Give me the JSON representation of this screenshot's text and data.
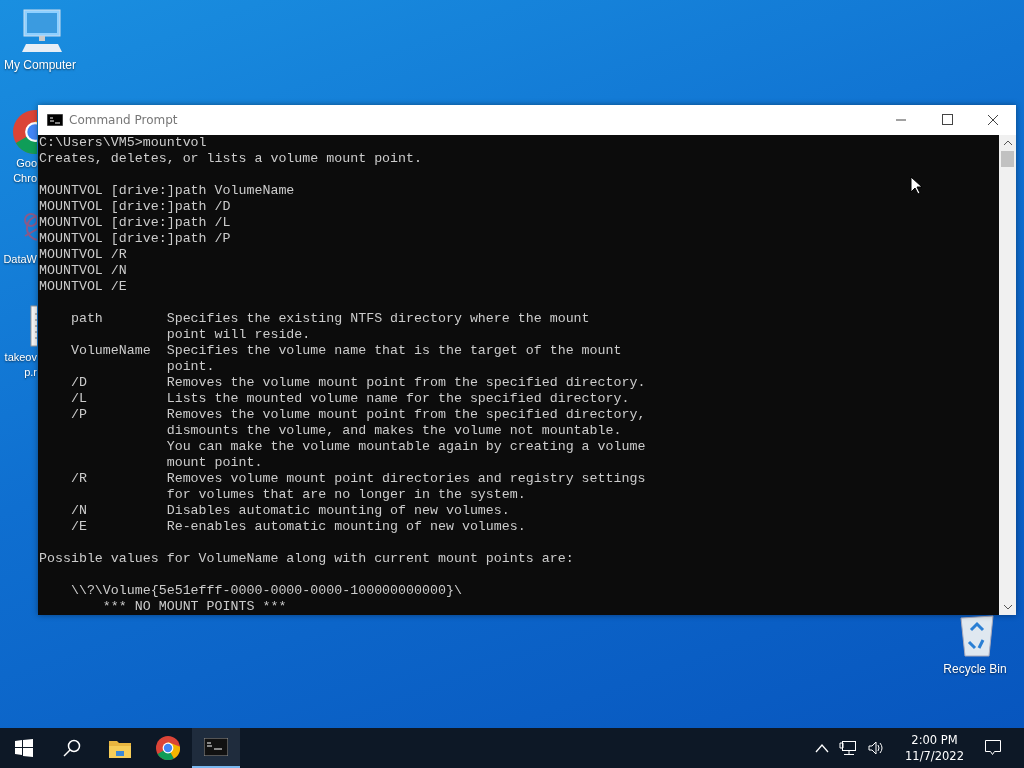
{
  "desktop_icons": [
    {
      "kind": "computer",
      "label": [
        "My Computer"
      ]
    },
    {
      "kind": "chrome",
      "label": [
        "Goo",
        "Chro"
      ]
    },
    {
      "kind": "app",
      "label": [
        "DataW"
      ]
    },
    {
      "kind": "document",
      "label": [
        "takeov",
        "p.r"
      ]
    },
    {
      "kind": "recycle",
      "label": [
        "Recycle Bin"
      ]
    }
  ],
  "window": {
    "title": "Command Prompt",
    "output_blocks": [
      [
        "C:\\Users\\VM5>mountvol",
        "Creates, deletes, or lists a volume mount point."
      ],
      [
        "MOUNTVOL [drive:]path VolumeName",
        "MOUNTVOL [drive:]path /D",
        "MOUNTVOL [drive:]path /L",
        "MOUNTVOL [drive:]path /P",
        "MOUNTVOL /R",
        "MOUNTVOL /N",
        "MOUNTVOL /E"
      ],
      [
        "    path        Specifies the existing NTFS directory where the mount",
        "                point will reside.",
        "    VolumeName  Specifies the volume name that is the target of the mount",
        "                point.",
        "    /D          Removes the volume mount point from the specified directory.",
        "    /L          Lists the mounted volume name for the specified directory.",
        "    /P          Removes the volume mount point from the specified directory,",
        "                dismounts the volume, and makes the volume not mountable.",
        "                You can make the volume mountable again by creating a volume",
        "                mount point.",
        "    /R          Removes volume mount point directories and registry settings",
        "                for volumes that are no longer in the system.",
        "    /N          Disables automatic mounting of new volumes.",
        "    /E          Re-enables automatic mounting of new volumes."
      ],
      [
        "Possible values for VolumeName along with current mount points are:"
      ],
      [
        "    \\\\?\\Volume{5e51efff-0000-0000-0000-100000000000}\\",
        "        *** NO MOUNT POINTS ***"
      ]
    ]
  },
  "taskbar": {
    "items": [
      {
        "kind": "start",
        "selected": false
      },
      {
        "kind": "search",
        "selected": false
      },
      {
        "kind": "explorer",
        "selected": false
      },
      {
        "kind": "chrome",
        "selected": false
      },
      {
        "kind": "terminal",
        "selected": true
      }
    ],
    "time": "2:00 PM",
    "date": "11/7/2022"
  }
}
